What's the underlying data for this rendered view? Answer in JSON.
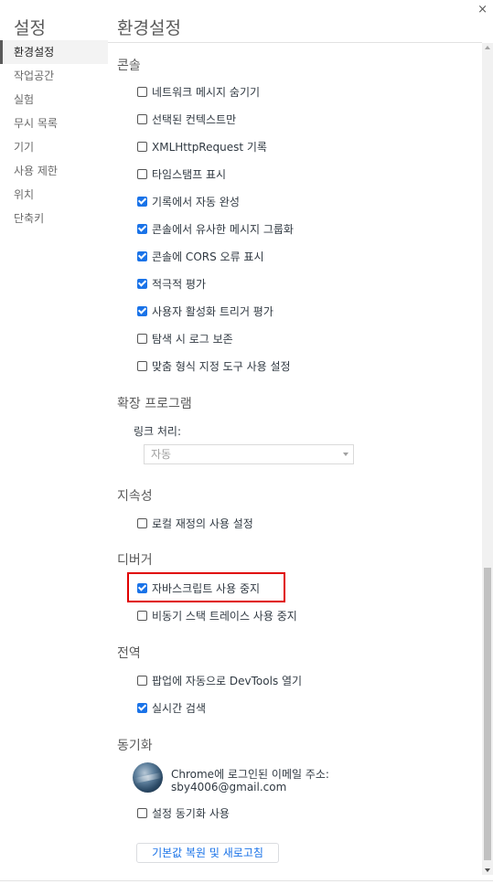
{
  "window": {
    "close_glyph": "×"
  },
  "sidebar": {
    "title": "설정",
    "items": [
      {
        "label": "환경설정",
        "selected": true
      },
      {
        "label": "작업공간"
      },
      {
        "label": "실험"
      },
      {
        "label": "무시 목록"
      },
      {
        "label": "기기"
      },
      {
        "label": "사용 제한"
      },
      {
        "label": "위치"
      },
      {
        "label": "단축키"
      }
    ]
  },
  "main": {
    "title": "환경설정",
    "sections": {
      "console": {
        "title": "콘솔",
        "options": [
          {
            "label": "네트워크 메시지 숨기기",
            "checked": false
          },
          {
            "label": "선택된 컨텍스트만",
            "checked": false
          },
          {
            "label": "XMLHttpRequest 기록",
            "checked": false
          },
          {
            "label": "타임스탬프 표시",
            "checked": false
          },
          {
            "label": "기록에서 자동 완성",
            "checked": true
          },
          {
            "label": "콘솔에서 유사한 메시지 그룹화",
            "checked": true
          },
          {
            "label": "콘솔에 CORS 오류 표시",
            "checked": true
          },
          {
            "label": "적극적 평가",
            "checked": true
          },
          {
            "label": "사용자 활성화 트리거 평가",
            "checked": true
          },
          {
            "label": "탐색 시 로그 보존",
            "checked": false
          },
          {
            "label": "맞춤 형식 지정 도구 사용 설정",
            "checked": false
          }
        ]
      },
      "extensions": {
        "title": "확장 프로그램",
        "link_handling_label": "링크 처리:",
        "link_handling_value": "자동"
      },
      "persistence": {
        "title": "지속성",
        "options": [
          {
            "label": "로컬 재정의 사용 설정",
            "checked": false
          }
        ]
      },
      "debugger": {
        "title": "디버거",
        "options": [
          {
            "label": "자바스크립트 사용 중지",
            "checked": true,
            "highlighted": true
          },
          {
            "label": "비동기 스택 트레이스 사용 중지",
            "checked": false
          }
        ]
      },
      "global": {
        "title": "전역",
        "options": [
          {
            "label": "팝업에 자동으로 DevTools 열기",
            "checked": false
          },
          {
            "label": "실시간 검색",
            "checked": true
          }
        ]
      },
      "sync": {
        "title": "동기화",
        "signed_in_label": "Chrome에 로그인된 이메일 주소:",
        "email": "sby4006@gmail.com",
        "options": [
          {
            "label": "설정 동기화 사용",
            "checked": false
          }
        ]
      }
    },
    "reset_button": "기본값 복원 및 새로고침"
  },
  "colors": {
    "accent": "#1a73e8",
    "highlight": "#e00000"
  }
}
